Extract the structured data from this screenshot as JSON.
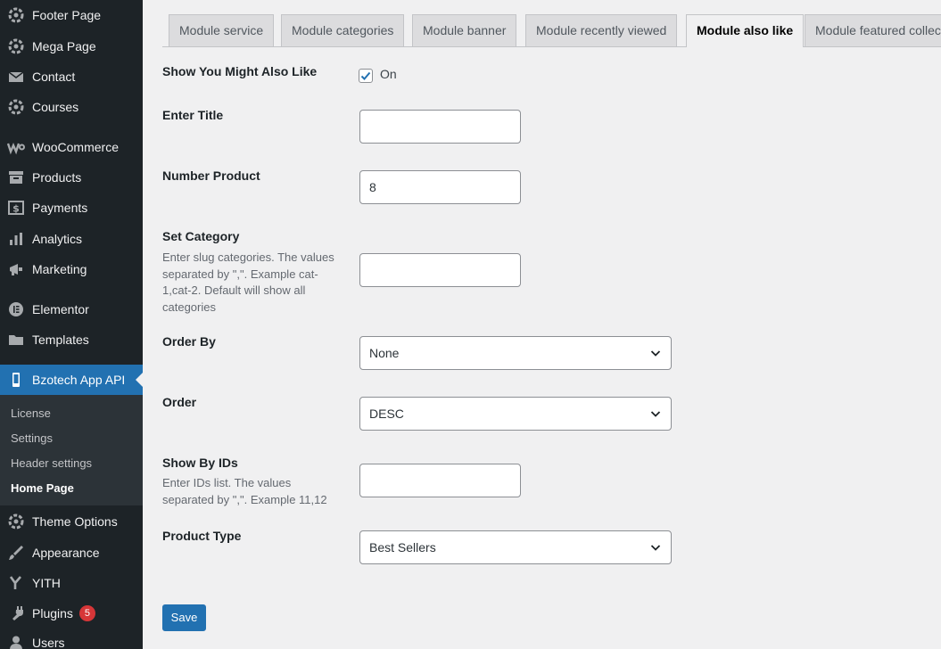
{
  "sidebar": {
    "items": [
      {
        "label": "Footer Page"
      },
      {
        "label": "Mega Page"
      },
      {
        "label": "Contact"
      },
      {
        "label": "Courses"
      },
      {
        "label": "WooCommerce"
      },
      {
        "label": "Products"
      },
      {
        "label": "Payments"
      },
      {
        "label": "Analytics"
      },
      {
        "label": "Marketing"
      },
      {
        "label": "Elementor"
      },
      {
        "label": "Templates"
      },
      {
        "label": "Bzotech App API"
      },
      {
        "label": "Theme Options"
      },
      {
        "label": "Appearance"
      },
      {
        "label": "YITH"
      },
      {
        "label": "Plugins",
        "badge": "5"
      },
      {
        "label": "Users"
      }
    ],
    "submenu": [
      {
        "label": "License"
      },
      {
        "label": "Settings"
      },
      {
        "label": "Header settings"
      },
      {
        "label": "Home Page"
      }
    ]
  },
  "tabs": [
    {
      "label": "Module service"
    },
    {
      "label": "Module categories"
    },
    {
      "label": "Module banner"
    },
    {
      "label": "Module recently viewed"
    },
    {
      "label": "Module also like"
    },
    {
      "label": "Module featured collection"
    }
  ],
  "form": {
    "show_also_like": {
      "label": "Show You Might Also Like",
      "checkbox_label": "On",
      "checked": true
    },
    "title": {
      "label": "Enter Title",
      "value": ""
    },
    "number_product": {
      "label": "Number Product",
      "value": "8"
    },
    "category": {
      "label": "Set Category",
      "description": "Enter slug categories. The values separated by \",\". Example cat-1,cat-2. Default will show all categories",
      "value": ""
    },
    "order_by": {
      "label": "Order By",
      "value": "None"
    },
    "order": {
      "label": "Order",
      "value": "DESC"
    },
    "ids": {
      "label": "Show By IDs",
      "description": "Enter IDs list. The values separated by \",\". Example 11,12",
      "value": ""
    },
    "product_type": {
      "label": "Product Type",
      "value": "Best Sellers"
    },
    "save_label": "Save"
  },
  "colors": {
    "sidebar_bg": "#1d2327",
    "accent": "#2271b1",
    "badge": "#d63638",
    "page_bg": "#f0f0f1"
  }
}
